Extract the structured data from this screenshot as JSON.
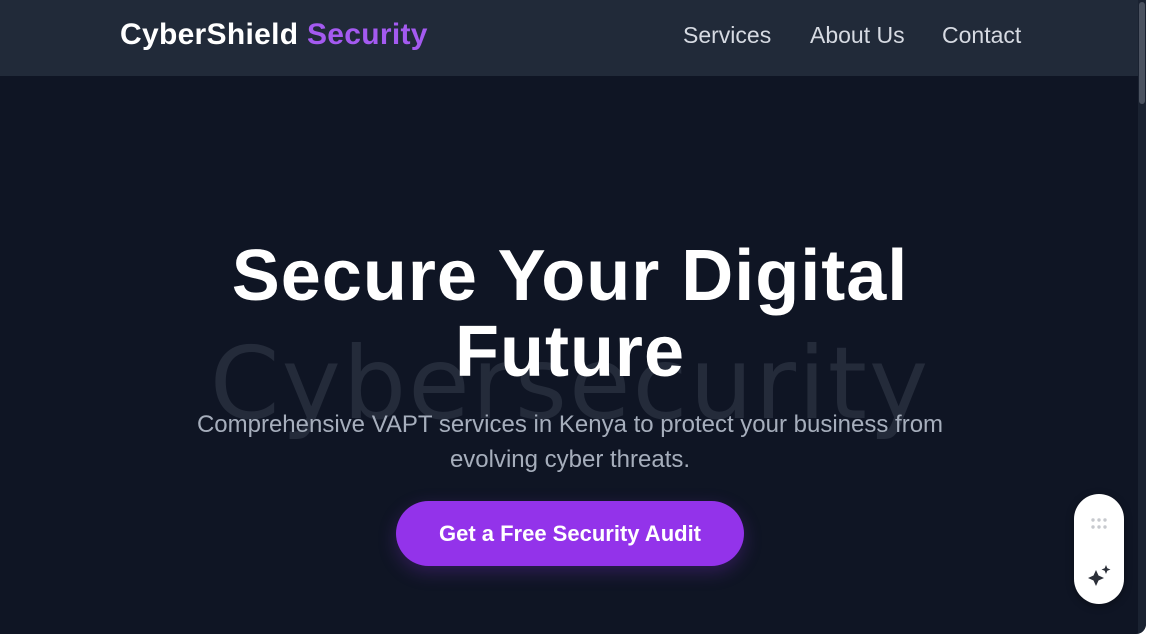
{
  "header": {
    "brand": {
      "name": "CyberShield",
      "accent": "Security"
    },
    "nav": [
      {
        "label": "Services"
      },
      {
        "label": "About Us"
      },
      {
        "label": "Contact"
      }
    ]
  },
  "hero": {
    "title_line1": "Secure Your Digital",
    "title_line2": "Future",
    "watermark": "Cybersecurity",
    "subtitle": "Comprehensive VAPT services in Kenya to protect your business from evolving cyber threats.",
    "cta_label": "Get a Free Security Audit"
  },
  "widget": {
    "icons": [
      "drag-handle-icon",
      "sparkle-icon"
    ]
  },
  "colors": {
    "background": "#0f1524",
    "header": "#212a39",
    "accent": "#a45af0",
    "button": "#9333ea",
    "subtitle": "#a6aebc"
  }
}
